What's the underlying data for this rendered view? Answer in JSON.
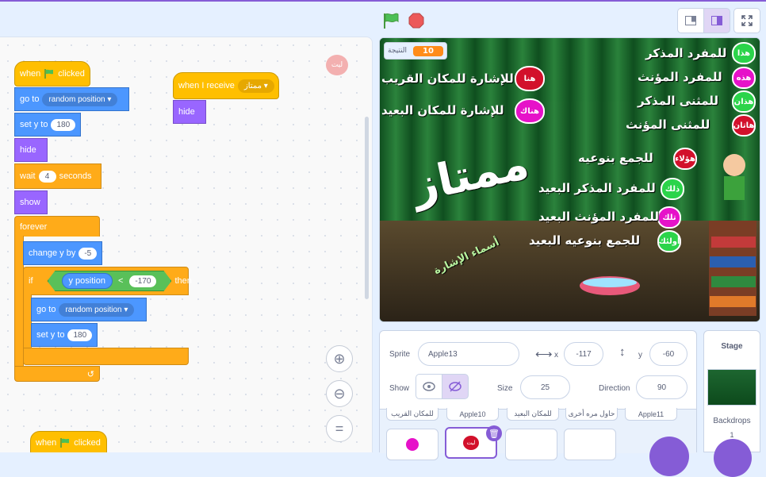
{
  "colors": {
    "motion": "#4c97ff",
    "events": "#ffbf00",
    "looks": "#9966ff",
    "control": "#ffab19",
    "operators": "#59c059",
    "accent": "#855cd6"
  },
  "topbar": {
    "green_flag": "green-flag-icon",
    "stop": "stop-icon",
    "small_stage": "small-stage-icon",
    "large_stage": "large-stage-icon",
    "fullscreen": "fullscreen-icon"
  },
  "script1": {
    "hat_when": "when",
    "hat_clicked": "clicked",
    "goto": "go to",
    "goto_dd": "random position",
    "sety": "set y to",
    "sety_val": "180",
    "hide": "hide",
    "wait": "wait",
    "wait_val": "4",
    "wait_unit": "seconds",
    "show": "show",
    "forever": "forever",
    "change": "change y by",
    "change_val": "-5",
    "if": "if",
    "ypos": "y position",
    "lt": "<",
    "cmp_val": "-170",
    "then": "then",
    "goto2": "go to",
    "goto2_dd": "random position",
    "sety2": "set y to",
    "sety2_val": "180"
  },
  "script2": {
    "when_receive": "when I receive",
    "receive_dd": "ممتاز",
    "hide": "hide"
  },
  "script3": {
    "when": "when",
    "clicked": "clicked"
  },
  "sprite_thumb": "ليت",
  "zoom": {
    "in": "zoom-in-icon",
    "out": "zoom-out-icon",
    "reset": "="
  },
  "stage": {
    "monitor_label": "النتيجة",
    "monitor_value": "10",
    "lines": [
      {
        "apple": "هذا",
        "text": "للمفرد المذكر"
      },
      {
        "apple": "هذه",
        "text": "للمفرد المؤنث"
      },
      {
        "apple": "هذان",
        "text": "للمثنى المذكر"
      },
      {
        "apple": "هاتان",
        "text": "للمثنى المؤنث"
      },
      {
        "apple": "هؤلاء",
        "text": "للجمع بنوعيه"
      },
      {
        "apple": "ذلك",
        "text": "للمفرد المذكر البعيد"
      },
      {
        "apple": "تلك",
        "text": "للمفرد المؤنث البعيد"
      },
      {
        "apple": "أولئك",
        "text": "للجمع بنوعيه البعيد"
      },
      {
        "apple": "هنا",
        "text": "للإشارة للمكان القريب"
      },
      {
        "apple": "هناك",
        "text": "للإشارة للمكان البعيد"
      }
    ],
    "big_word": "ممتاز",
    "curved_title": "أسماء الإشارة"
  },
  "sprite_panel": {
    "sprite_label": "Sprite",
    "sprite_name": "Apple13",
    "x_label": "x",
    "x_val": "-117",
    "y_label": "y",
    "y_val": "-60",
    "show_label": "Show",
    "size_label": "Size",
    "size_val": "25",
    "direction_label": "Direction",
    "direction_val": "90",
    "tiles": [
      "للمكان القريب",
      "Apple10",
      "للمكان البعيد",
      "حاول مره أخرى",
      "Apple11"
    ],
    "thumb_labels": [
      "ليت"
    ]
  },
  "stage_panel": {
    "title": "Stage",
    "backdrops_label": "Backdrops",
    "backdrops_count": "1"
  }
}
